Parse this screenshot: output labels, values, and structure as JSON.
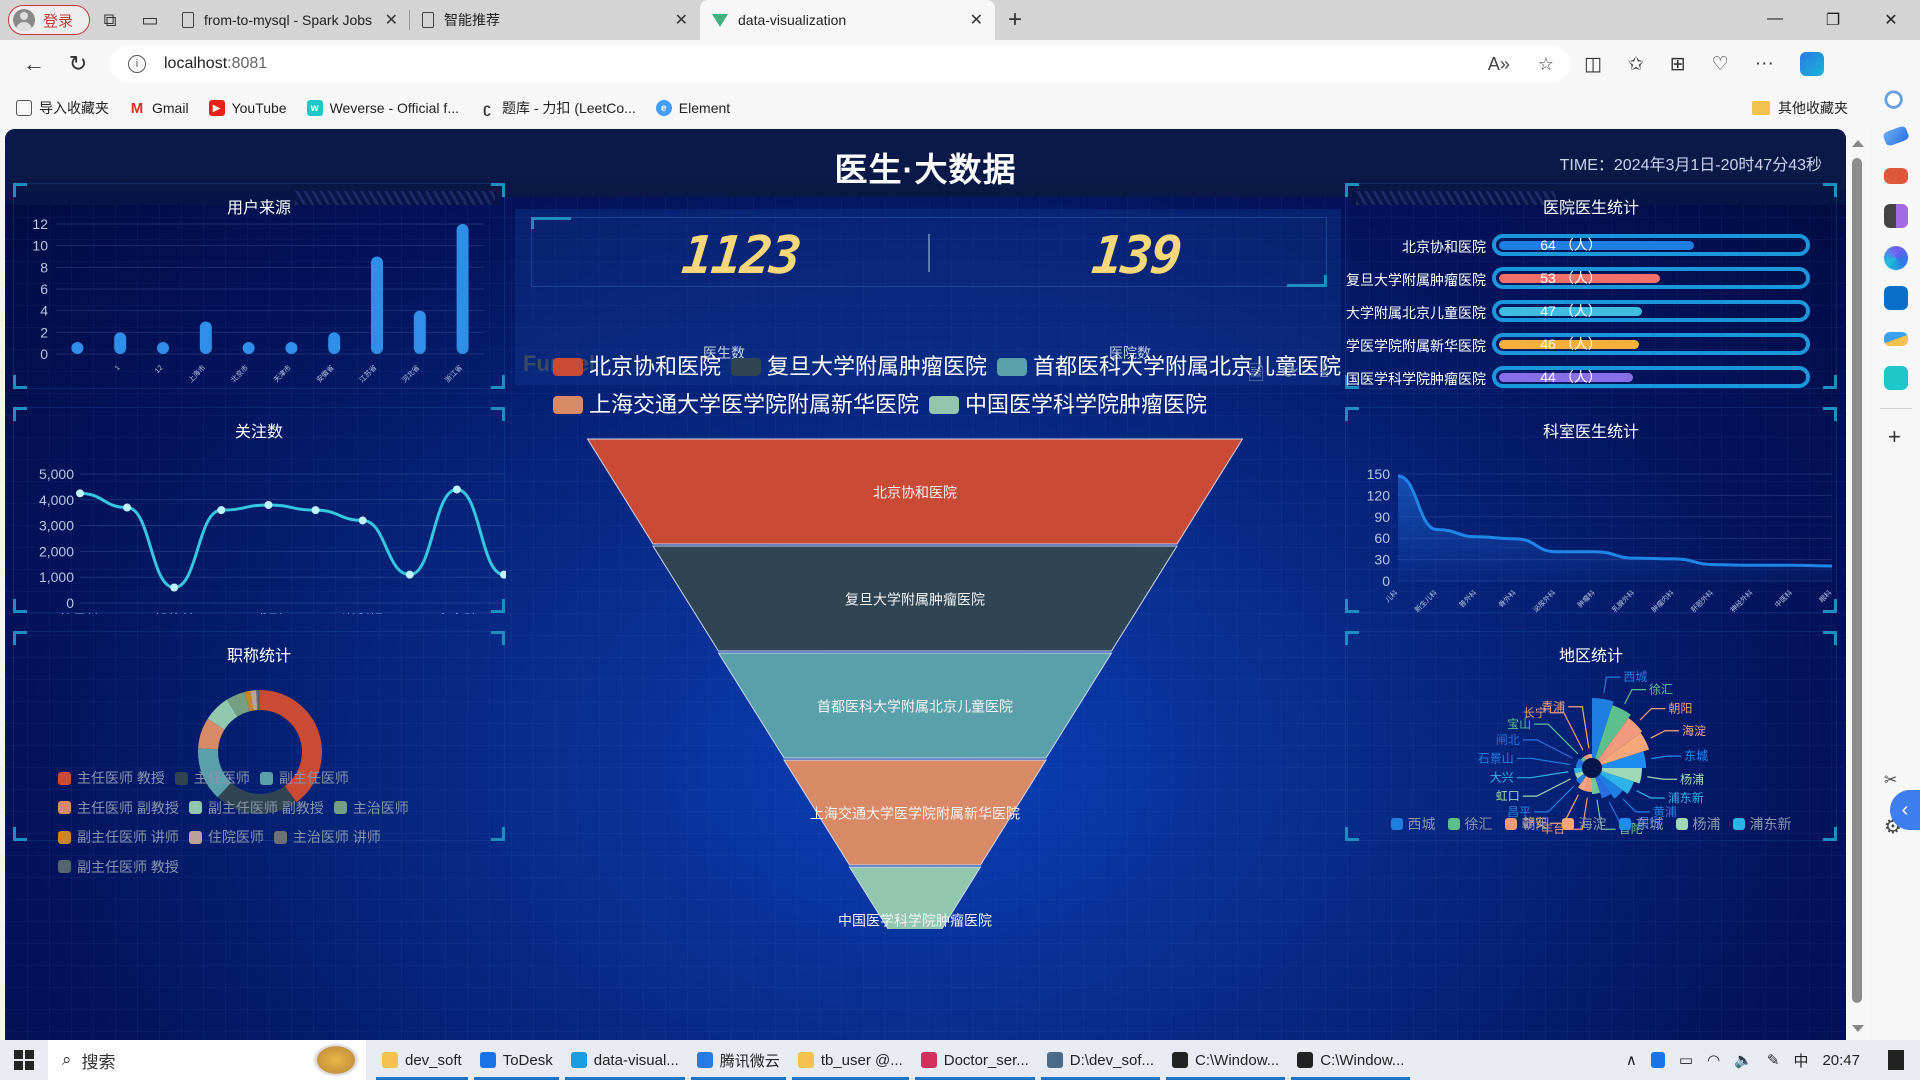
{
  "browser": {
    "login_label": "登录",
    "tabs": [
      {
        "title": "from-to-mysql - Spark Jobs",
        "active": false
      },
      {
        "title": "智能推荐",
        "active": false
      },
      {
        "title": "data-visualization",
        "active": true
      }
    ],
    "url_host": "localhost",
    "url_port": ":8081",
    "bookmarks": [
      {
        "label": "导入收藏夹",
        "icon": "import-icon",
        "color": "#555555"
      },
      {
        "label": "Gmail",
        "icon": "gmail-icon",
        "color": "#d93025"
      },
      {
        "label": "YouTube",
        "icon": "youtube-icon",
        "color": "#e62117"
      },
      {
        "label": "Weverse - Official f...",
        "icon": "weverse-icon",
        "color": "#1ec8c8"
      },
      {
        "label": "题库 - 力扣 (LeetCo...",
        "icon": "leetcode-icon",
        "color": "#f0a020"
      },
      {
        "label": "Element",
        "icon": "element-icon",
        "color": "#409eff"
      }
    ],
    "other_bookmarks": "其他收藏夹"
  },
  "dashboard": {
    "title": "医生·大数据",
    "time": "TIME：2024年3月1日-20时47分43秒",
    "colors": {
      "accent": "#1e8dc0",
      "digit": "#f6d77a",
      "bar": "#2e8ee8",
      "line": "#36c7e0"
    },
    "stats": {
      "doctor_count": "1123",
      "doctor_label": "医生数",
      "hospital_count": "139",
      "hospital_label": "医院数"
    },
    "panels": {
      "user_source": "用户来源",
      "follow": "关注数",
      "title_stats": "职称统计",
      "hospital_doctors": "医院医生统计",
      "dept_doctors": "科室医生统计",
      "region": "地区统计",
      "funnel_ghost": "Funnel"
    },
    "toolbox": [
      "data-view-icon",
      "restore-icon",
      "save-image-icon"
    ]
  },
  "chart_data": [
    {
      "id": "user_source",
      "type": "bar",
      "title": "用户来源",
      "categories": [
        "",
        "1",
        "12",
        "上海市",
        "北京市",
        "天津市",
        "安徽省",
        "江苏省",
        "河北省",
        "浙江省"
      ],
      "values": [
        1,
        2,
        1,
        3,
        1,
        1,
        2,
        9,
        4,
        12
      ],
      "ylim": [
        0,
        12
      ],
      "yticks": [
        0,
        2,
        4,
        6,
        8,
        10,
        12
      ],
      "grid": true
    },
    {
      "id": "follow",
      "type": "line",
      "title": "关注数",
      "categories": [
        "徐灵敏",
        "",
        "郭佳林",
        "",
        "裘刚",
        "",
        "谢利娟",
        "",
        "俞全胜",
        ""
      ],
      "values": [
        4250,
        3700,
        600,
        3600,
        3800,
        3600,
        3200,
        1100,
        4400,
        1100
      ],
      "ylim": [
        0,
        5000
      ],
      "yticks": [
        "0",
        "1,000",
        "2,000",
        "3,000",
        "4,000",
        "5,000"
      ],
      "smooth": true,
      "grid": true
    },
    {
      "id": "title_stats",
      "type": "pie",
      "title": "职称统计",
      "donut": true,
      "legend": "bottom",
      "slices": [
        {
          "name": "主任医师 教授",
          "value": 40,
          "color": "#c94a35"
        },
        {
          "name": "主任医师",
          "value": 22,
          "color": "#2f4554"
        },
        {
          "name": "副主任医师",
          "value": 14,
          "color": "#5aa0aa"
        },
        {
          "name": "主任医师 副教授",
          "value": 8,
          "color": "#d88966"
        },
        {
          "name": "副主任医师 副教授",
          "value": 7,
          "color": "#91c7ae"
        },
        {
          "name": "主治医师",
          "value": 5,
          "color": "#749f83"
        },
        {
          "name": "副主任医师 讲师",
          "value": 1.5,
          "color": "#ca8622"
        },
        {
          "name": "住院医师",
          "value": 1.5,
          "color": "#bda29a"
        },
        {
          "name": "主治医师 讲师",
          "value": 0.5,
          "color": "#6e7074"
        },
        {
          "name": "副主任医师 教授",
          "value": 0.5,
          "color": "#546570"
        }
      ]
    },
    {
      "id": "funnel",
      "type": "funnel",
      "legend": "top",
      "stages": [
        {
          "name": "北京协和医院",
          "value": 64,
          "color": "#c94a35"
        },
        {
          "name": "复旦大学附属肿瘤医院",
          "value": 53,
          "color": "#2f4554"
        },
        {
          "name": "首都医科大学附属北京儿童医院",
          "value": 47,
          "color": "#5aa0aa"
        },
        {
          "name": "上海交通大学医学院附属新华医院",
          "value": 46,
          "color": "#d88966"
        },
        {
          "name": "中国医学科学院肿瘤医院",
          "value": 44,
          "color": "#91c7ae"
        }
      ]
    },
    {
      "id": "hospital_doctors",
      "type": "bar",
      "orientation": "horizontal",
      "title": "医院医生统计",
      "xlim": [
        0,
        100
      ],
      "unit": "（人）",
      "items": [
        {
          "name": "北京协和医院",
          "value": 64,
          "color": "#1f7fe0"
        },
        {
          "name": "复旦大学附属肿瘤医院",
          "value": 53,
          "color": "#f1716a"
        },
        {
          "name": "首都医科大学附属北京儿童医院",
          "value": 47,
          "color": "#3fbde0"
        },
        {
          "name": "上海交通大学医学院附属新华医院",
          "value": 46,
          "color": "#f7b03a"
        },
        {
          "name": "中国医学科学院肿瘤医院",
          "value": 44,
          "color": "#8a6ee8"
        }
      ]
    },
    {
      "id": "dept_doctors",
      "type": "area",
      "title": "科室医生统计",
      "categories": [
        "儿科",
        "新生儿科",
        "普外科",
        "骨外科",
        "泌尿外科",
        "肿瘤科",
        "乳腺外科",
        "肿瘤内科",
        "肝胆外科",
        "神经外科",
        "中医科",
        "眼科"
      ],
      "values": [
        147,
        72,
        62,
        59,
        41,
        41,
        32,
        31,
        23,
        22,
        22,
        21
      ],
      "ylim": [
        0,
        150
      ],
      "yticks": [
        0,
        30,
        60,
        90,
        120,
        150
      ],
      "smooth": true
    },
    {
      "id": "region",
      "type": "pie",
      "subtype": "rose",
      "title": "地区统计",
      "legend": "bottom",
      "legend_visible": [
        "西城",
        "徐汇",
        "朝阳",
        "海淀",
        "东城",
        "杨浦",
        "浦东新"
      ],
      "slices": [
        {
          "name": "西城",
          "value": 30,
          "color": "#1f7fe0"
        },
        {
          "name": "徐汇",
          "value": 28,
          "color": "#5bbf8e"
        },
        {
          "name": "朝阳",
          "value": 26,
          "color": "#f19a7e"
        },
        {
          "name": "海淀",
          "value": 25,
          "color": "#f7a57a"
        },
        {
          "name": "东城",
          "value": 22,
          "color": "#1d8cf2"
        },
        {
          "name": "杨浦",
          "value": 20,
          "color": "#9ed8b4"
        },
        {
          "name": "浦东新",
          "value": 17,
          "color": "#2eb3e8"
        },
        {
          "name": "黄浦",
          "value": 14,
          "color": "#1f7fe0"
        },
        {
          "name": "闵行",
          "value": 11,
          "color": "#2a6ee0"
        },
        {
          "name": "普陀",
          "value": 8,
          "color": "#6fc79a"
        },
        {
          "name": "丰台",
          "value": 7,
          "color": "#f19a7e"
        },
        {
          "name": "静安",
          "value": 7,
          "color": "#f7a57a"
        },
        {
          "name": "昌平",
          "value": 5,
          "color": "#1f7fe0"
        },
        {
          "name": "虹口",
          "value": 4,
          "color": "#9ed8b4"
        },
        {
          "name": "大兴",
          "value": 4,
          "color": "#2eb3e8"
        },
        {
          "name": "石景山",
          "value": 3,
          "color": "#1f7fe0"
        },
        {
          "name": "闸北",
          "value": 3,
          "color": "#2a6ee0"
        },
        {
          "name": "宝山",
          "value": 2,
          "color": "#5bbf8e"
        },
        {
          "name": "长宁",
          "value": 2,
          "color": "#f19a7e"
        },
        {
          "name": "青浦",
          "value": 2,
          "color": "#f7a57a"
        }
      ]
    }
  ],
  "taskbar": {
    "search_label": "搜索",
    "items": [
      {
        "label": "dev_soft",
        "icon": "folder-icon",
        "color": "#f2c14e"
      },
      {
        "label": "ToDesk",
        "icon": "todesk-icon",
        "color": "#1a73e8"
      },
      {
        "label": "data-visual...",
        "icon": "edge-icon",
        "color": "#1b9de2"
      },
      {
        "label": "腾讯微云",
        "icon": "weiyun-icon",
        "color": "#2a7ae2"
      },
      {
        "label": "tb_user @...",
        "icon": "navicat-icon",
        "color": "#f2c14e"
      },
      {
        "label": "Doctor_ser...",
        "icon": "intellij-icon",
        "color": "#d0315c"
      },
      {
        "label": "D:\\dev_sof...",
        "icon": "window-icon",
        "color": "#4a6a8a"
      },
      {
        "label": "C:\\Window...",
        "icon": "cmd-icon",
        "color": "#222222"
      },
      {
        "label": "C:\\Window...",
        "icon": "cmd-icon",
        "color": "#222222"
      }
    ],
    "ime": "中",
    "clock": "20:47"
  }
}
